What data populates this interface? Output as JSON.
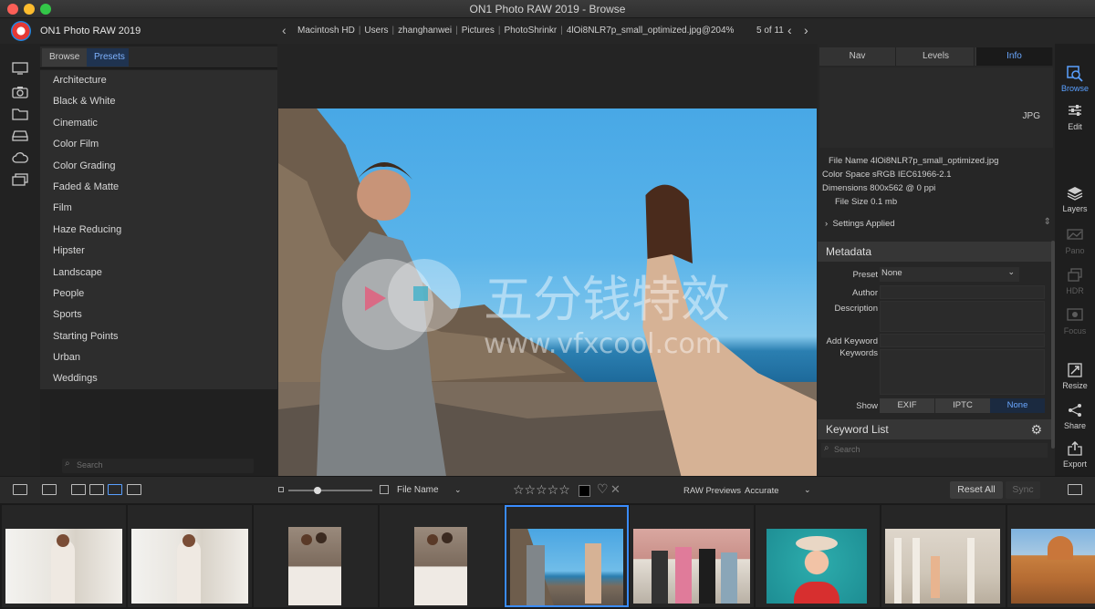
{
  "window": {
    "title": "ON1 Photo RAW 2019 - Browse"
  },
  "topbar": {
    "app_name": "ON1 Photo RAW 2019",
    "breadcrumb": [
      "Macintosh HD",
      "Users",
      "zhanghanwei",
      "Pictures",
      "PhotoShrinkr",
      "4lOi8NLR7p_small_optimized.jpg@204%"
    ],
    "counter": "5 of 11"
  },
  "left_rail": {
    "icons": [
      "monitor-icon",
      "camera-icon",
      "folder-icon",
      "drive-icon",
      "cloud-icon",
      "albums-icon"
    ]
  },
  "left_panel": {
    "tabs": {
      "browse": "Browse",
      "presets": "Presets"
    },
    "presets": [
      "Architecture",
      "Black & White",
      "Cinematic",
      "Color Film",
      "Color Grading",
      "Faded & Matte",
      "Film",
      "Haze Reducing",
      "Hipster",
      "Landscape",
      "People",
      "Sports",
      "Starting Points",
      "Urban",
      "Weddings"
    ],
    "search_placeholder": "Search"
  },
  "viewer": {
    "watermark_text": "五分钱特效",
    "watermark_url": "www.vfxcool.com"
  },
  "right_panel": {
    "tabs": {
      "nav": "Nav",
      "levels": "Levels",
      "info": "Info"
    },
    "info": {
      "format": "JPG",
      "file_name": "File Name 4lOi8NLR7p_small_optimized.jpg",
      "color_space": "Color Space sRGB IEC61966-2.1",
      "dimensions": "Dimensions 800x562 @ 0 ppi",
      "file_size": "File Size 0.1 mb",
      "settings_applied": "Settings Applied"
    },
    "metadata": {
      "title": "Metadata",
      "preset_label": "Preset",
      "preset_value": "None",
      "author_label": "Author",
      "description_label": "Description",
      "add_keyword_label": "Add Keyword",
      "keywords_label": "Keywords",
      "show_label": "Show",
      "show_tabs": {
        "exif": "EXIF",
        "iptc": "IPTC",
        "none": "None"
      }
    },
    "keyword_list": {
      "title": "Keyword List",
      "search_placeholder": "Search"
    }
  },
  "right_rail": {
    "browse": "Browse",
    "edit": "Edit",
    "layers": "Layers",
    "pano": "Pano",
    "hdr": "HDR",
    "focus": "Focus",
    "resize": "Resize",
    "share": "Share",
    "export": "Export"
  },
  "filmstrip_toolbar": {
    "sort_label": "File Name",
    "rating_stars": "☆☆☆☆☆",
    "raw_previews_label": "RAW Previews",
    "raw_previews_value": "Accurate",
    "reset_all": "Reset All",
    "sync": "Sync",
    "zoom_level": 0.35
  },
  "filmstrip": {
    "count": 9,
    "selected_index": 4
  },
  "colors": {
    "accent": "#3a8cff",
    "panel": "#262626",
    "background": "#1e1e1e"
  }
}
